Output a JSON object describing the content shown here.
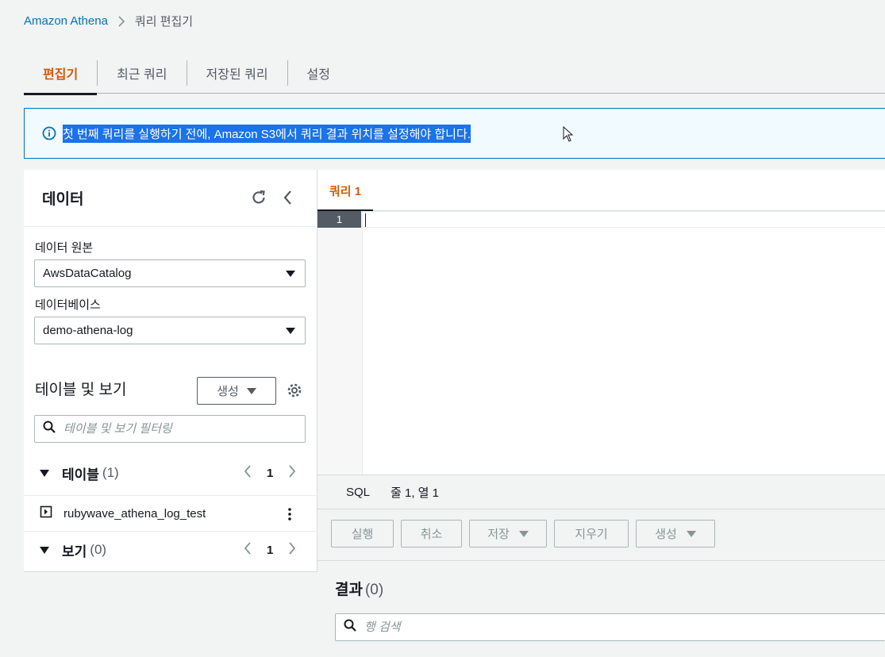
{
  "breadcrumb": {
    "root": "Amazon Athena",
    "current": "쿼리 편집기"
  },
  "tabs": [
    {
      "label": "편집기",
      "active": true
    },
    {
      "label": "최근 쿼리",
      "active": false
    },
    {
      "label": "저장된 쿼리",
      "active": false
    },
    {
      "label": "설정",
      "active": false
    }
  ],
  "banner": {
    "text": "첫 번째 쿼리를 실행하기 전에, Amazon S3에서 쿼리 결과 위치를 설정해야 합니다."
  },
  "data_panel": {
    "title": "데이터",
    "data_source_label": "데이터 원본",
    "data_source_value": "AwsDataCatalog",
    "database_label": "데이터베이스",
    "database_value": "demo-athena-log",
    "tables_views_title": "테이블 및 보기",
    "create_label": "생성",
    "filter_placeholder": "테이블 및 보기 필터링",
    "tables_label": "테이블",
    "tables_count": "(1)",
    "tables_page": "1",
    "table_items": [
      "rubywave_athena_log_test"
    ],
    "views_label": "보기",
    "views_count": "(0)",
    "views_page": "1"
  },
  "editor": {
    "tab_label": "쿼리 1",
    "line_number": "1",
    "language": "SQL",
    "cursor_position": "줄 1, 열 1"
  },
  "actions": {
    "run": "실행",
    "cancel": "취소",
    "save": "저장",
    "clear": "지우기",
    "create": "생성"
  },
  "results": {
    "title": "결과",
    "count": "(0)",
    "search_placeholder": "행 검색"
  },
  "colors": {
    "accent_orange": "#d45b07",
    "link_blue": "#0073bb",
    "selection_blue": "#1a73e8"
  }
}
